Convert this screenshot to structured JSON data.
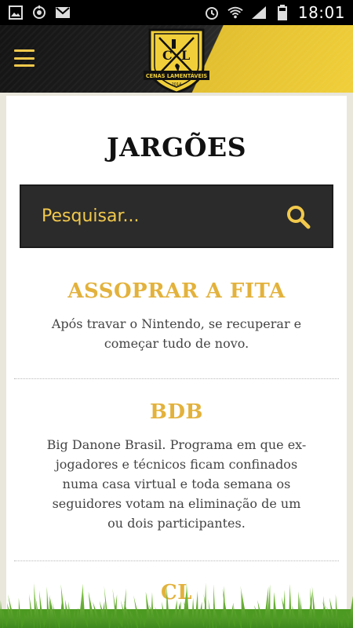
{
  "status_bar": {
    "left_icons": [
      "image-notification-icon",
      "sync-notification-icon",
      "gmail-notification-icon"
    ],
    "right_icons": [
      "alarm-icon",
      "wifi-icon",
      "signal-icon",
      "battery-icon"
    ],
    "time": "18:01"
  },
  "header": {
    "logo": {
      "left_letter": "C",
      "right_letter": "L",
      "banner_text": "CENAS LAMENTÁVEIS",
      "year": "2014"
    }
  },
  "page": {
    "title": "JARGÕES"
  },
  "search": {
    "placeholder": "Pesquisar..."
  },
  "entries": [
    {
      "term": "ASSOPRAR A FITA",
      "definition": "Após travar o Nintendo, se recuperar e começar tudo de novo."
    },
    {
      "term": "BDB",
      "definition": "Big Danone Brasil. Programa em que ex-jogadores e técnicos ficam confinados numa casa virtual e toda semana os seguidores votam na eliminação de um ou dois participantes."
    },
    {
      "term": "CL",
      "definition": ""
    }
  ],
  "colors": {
    "accent": "#e3b23c",
    "search_text": "#f2c94c",
    "header_dark": "#1f1f1f",
    "header_yellow": "#f0cf3a"
  }
}
